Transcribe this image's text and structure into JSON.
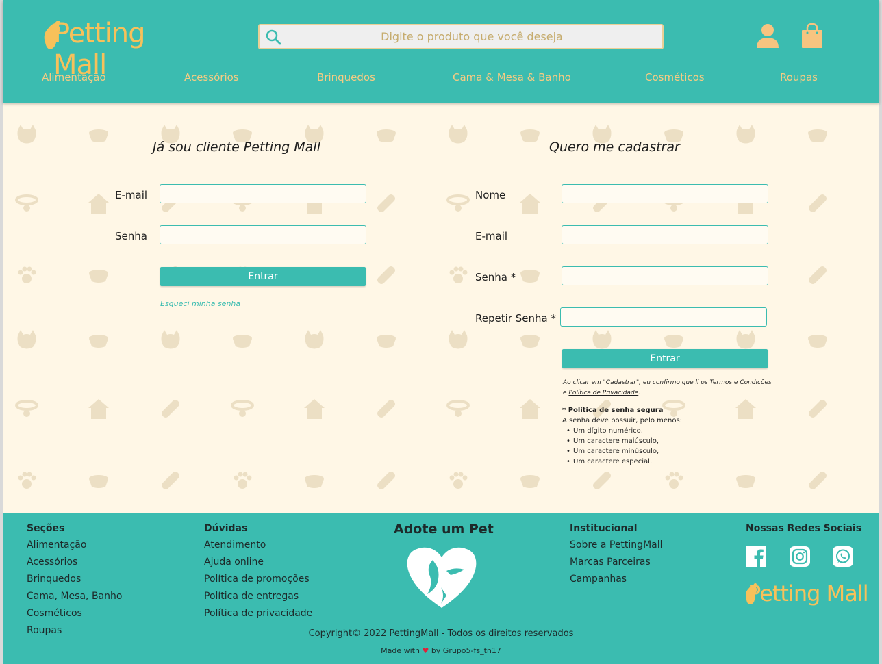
{
  "header": {
    "logo_text": "Petting Mall",
    "search_placeholder": "Digite o produto que você deseja",
    "user_icon": "user-icon",
    "cart_icon": "shopping-bag-icon"
  },
  "nav": {
    "items": [
      "Alimentação",
      "Acessórios",
      "Brinquedos",
      "Cama & Mesa & Banho",
      "Cosméticos",
      "Roupas"
    ]
  },
  "login": {
    "title": "Já sou cliente Petting Mall",
    "email_label": "E-mail",
    "password_label": "Senha",
    "submit_label": "Entrar",
    "forgot_label": "Esqueci minha senha"
  },
  "register": {
    "title": "Quero me cadastrar",
    "name_label": "Nome",
    "email_label": "E-mail",
    "password_label": "Senha *",
    "repeat_label": "Repetir Senha *",
    "submit_label": "Entrar",
    "terms_prefix": "Ao clicar em \"Cadastrar\", eu confirmo que li os ",
    "terms_link": "Termos e Condições",
    "terms_mid": "e ",
    "privacy_link": "Política de Privacidade",
    "terms_suffix": ".",
    "policy_title": "* Política de senha segura",
    "policy_intro": "A senha deve possuir, pelo menos:",
    "policy_rules": [
      "Um dígito numérico,",
      "Um caractere maiúsculo,",
      "Um caractere minúsculo,",
      "Um caractere especial."
    ]
  },
  "footer": {
    "sections": {
      "title": "Seções",
      "links": [
        "Alimentação",
        "Acessórios",
        "Brinquedos",
        "Cama, Mesa, Banho",
        "Cosméticos",
        "Roupas"
      ]
    },
    "doubts": {
      "title": "Dúvidas",
      "links": [
        "Atendimento",
        "Ajuda online",
        "Política de promoções",
        "Política de entregas",
        "Política de privacidade"
      ]
    },
    "adopt": {
      "title": "Adote um Pet"
    },
    "institutional": {
      "title": "Institucional",
      "links": [
        "Sobre a PettingMall",
        "Marcas Parceiras",
        "Campanhas"
      ]
    },
    "social": {
      "title": "Nossas Redes Sociais",
      "icons": [
        "facebook-icon",
        "instagram-icon",
        "whatsapp-icon"
      ]
    },
    "logo_text": "Petting Mall",
    "copyright": "Copyright© 2022 PettingMall - Todos os direitos reservados",
    "made_prefix": "Made with",
    "made_suffix": "by Grupo5-fs_tn17"
  },
  "colors": {
    "primary": "#3bbcb0",
    "accent": "#f7c15a",
    "background": "#fff7e6"
  }
}
